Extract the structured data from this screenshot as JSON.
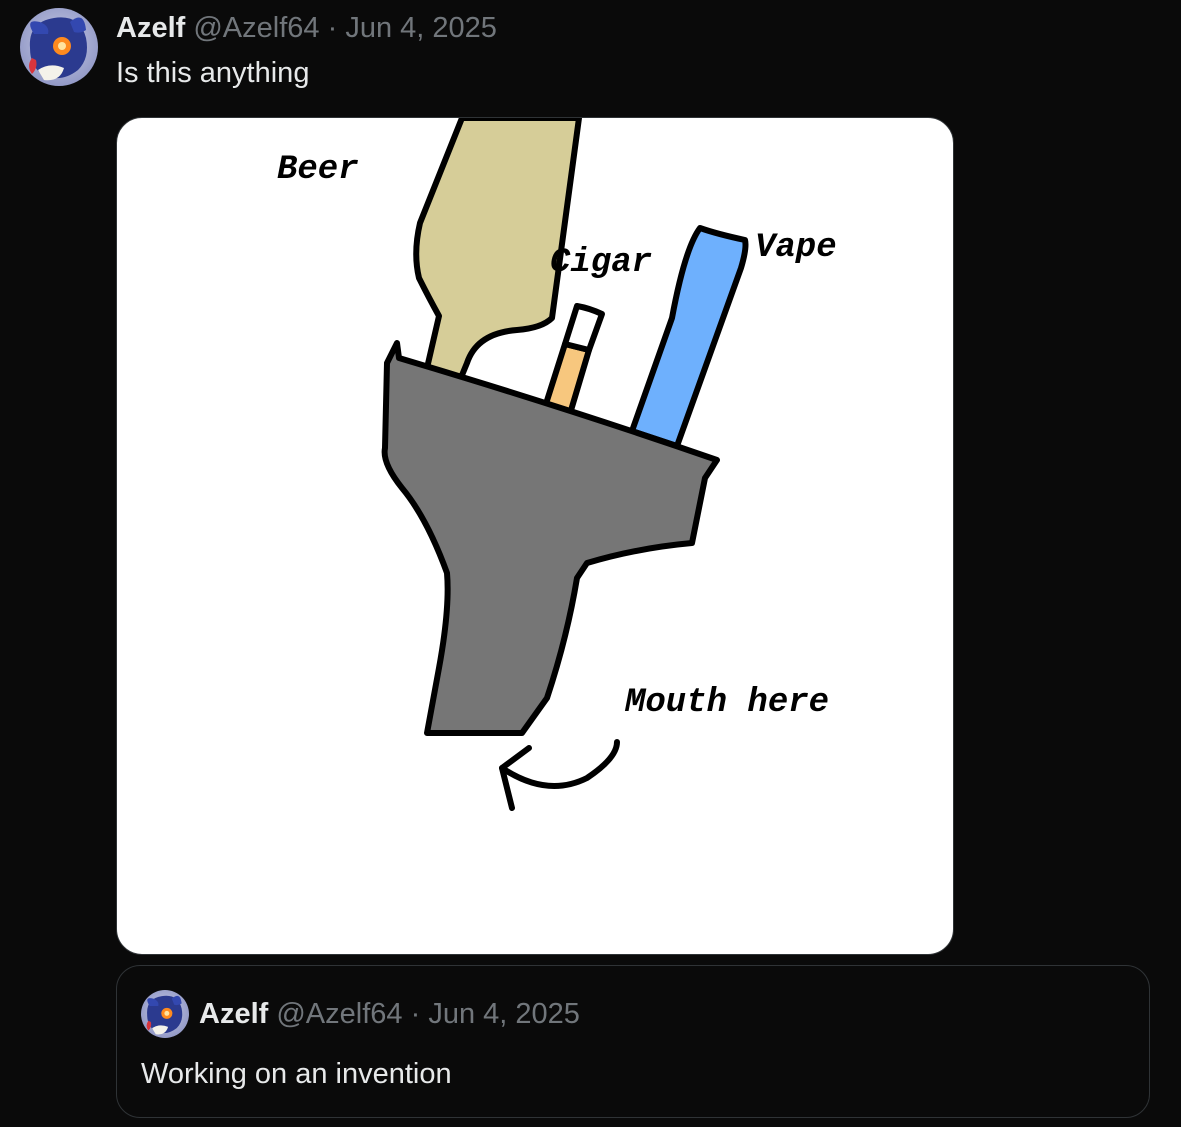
{
  "tweet": {
    "author_name": "Azelf",
    "author_handle": "@Azelf64",
    "separator": "·",
    "date": "Jun 4, 2025",
    "text": "Is this anything",
    "avatar_icon": "azelf-avatar-icon"
  },
  "media": {
    "labels": {
      "beer": "Beer",
      "cigar": "Cigar",
      "vape": "Vape",
      "mouth": "Mouth here"
    },
    "colors": {
      "beer": "#d6cd98",
      "cigar": "#f7c77e",
      "vape": "#6eb0fd",
      "body": "#767676",
      "outline": "#000000",
      "background": "#ffffff"
    }
  },
  "quoted_tweet": {
    "author_name": "Azelf",
    "author_handle": "@Azelf64",
    "separator": "·",
    "date": "Jun 4, 2025",
    "text": "Working on an invention"
  },
  "theme": {
    "background": "#0a0a0a",
    "text": "#e7e9ea",
    "muted": "#71767b",
    "border": "#2f3336"
  }
}
